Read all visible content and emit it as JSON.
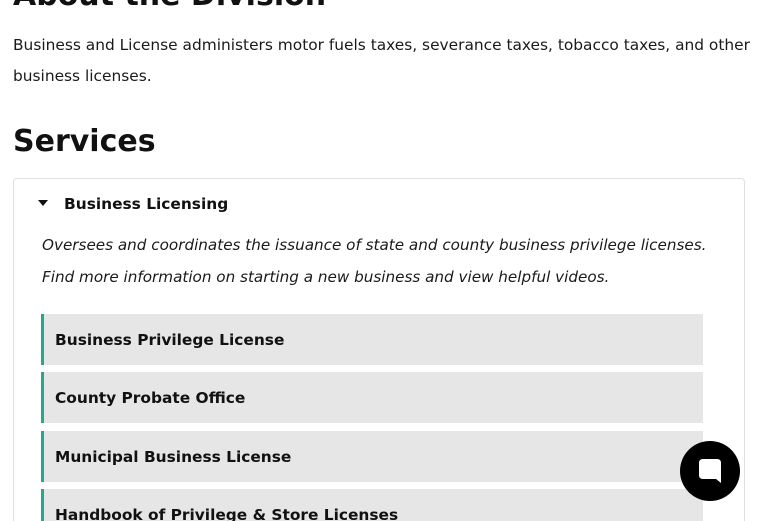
{
  "about": {
    "heading": "About the Division",
    "text": "Business and License administers motor fuels taxes, severance taxes, tobacco taxes, and other business licenses."
  },
  "services": {
    "heading": "Services",
    "accordion": {
      "title": "Business Licensing",
      "description": "Oversees and coordinates the issuance of state and county business privilege licenses. Find more information on starting a new business and view helpful videos.",
      "links": [
        {
          "label": "Business Privilege License"
        },
        {
          "label": "County Probate Office"
        },
        {
          "label": "Municipal Business License"
        },
        {
          "label": "Handbook of Privilege & Store Licenses"
        }
      ]
    }
  },
  "chat": {
    "icon": "chat-bubble-icon"
  },
  "colors": {
    "accent": "#28a88a",
    "link_bg": "#e6e6e6",
    "chat_bg": "#000000"
  }
}
